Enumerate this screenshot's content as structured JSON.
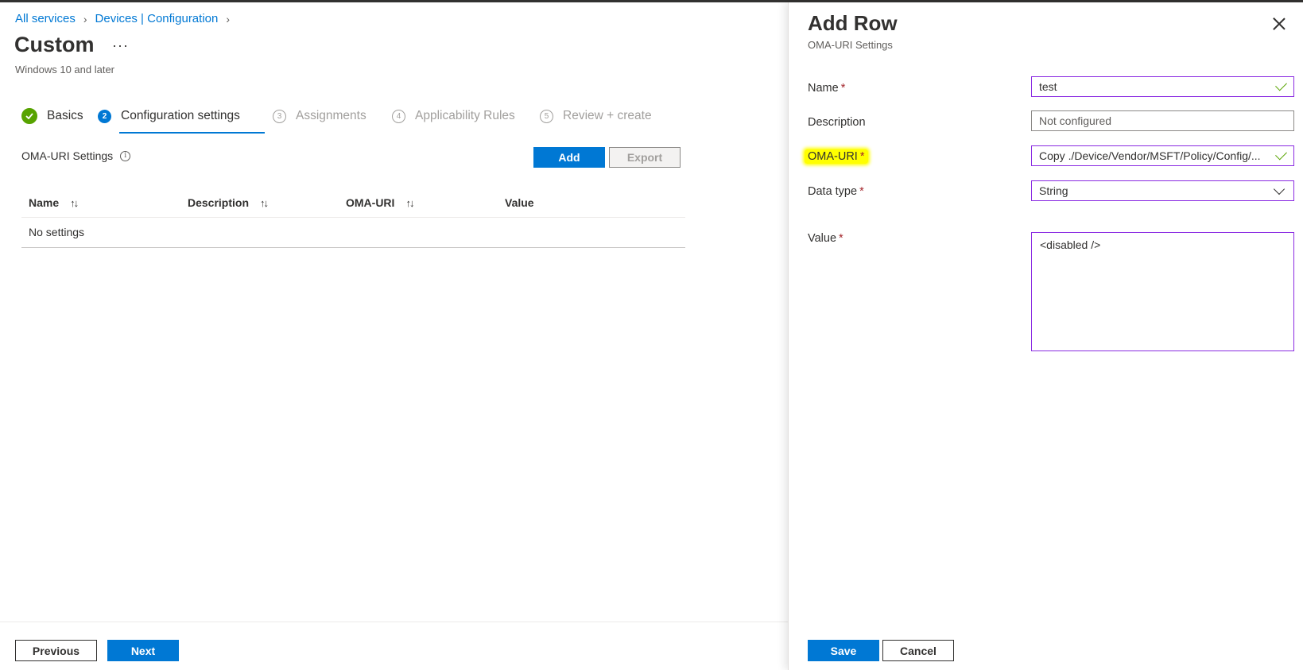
{
  "breadcrumb": {
    "items": [
      "All services",
      "Devices | Configuration"
    ]
  },
  "page": {
    "title": "Custom",
    "more": "···",
    "subtitle": "Windows 10 and later"
  },
  "steps": [
    {
      "num": "✓",
      "label": "Basics",
      "state": "done"
    },
    {
      "num": "2",
      "label": "Configuration settings",
      "state": "active"
    },
    {
      "num": "3",
      "label": "Assignments",
      "state": "disabled"
    },
    {
      "num": "4",
      "label": "Applicability Rules",
      "state": "disabled"
    },
    {
      "num": "5",
      "label": "Review + create",
      "state": "disabled"
    }
  ],
  "settings": {
    "label": "OMA-URI Settings",
    "info_icon": "i",
    "add_label": "Add",
    "export_label": "Export",
    "columns": [
      "Name",
      "Description",
      "OMA-URI",
      "Value"
    ],
    "sort_icon": "↑↓",
    "empty_text": "No settings"
  },
  "footer": {
    "previous_label": "Previous",
    "next_label": "Next"
  },
  "panel": {
    "title": "Add Row",
    "subtitle": "OMA-URI Settings",
    "required_mark": "*",
    "fields": {
      "name": {
        "label": "Name",
        "value": "test"
      },
      "description": {
        "label": "Description",
        "placeholder": "Not configured"
      },
      "oma_uri": {
        "label": "OMA-URI",
        "value": "Copy ./Device/Vendor/MSFT/Policy/Config/..."
      },
      "data_type": {
        "label": "Data type",
        "value": "String"
      },
      "value": {
        "label": "Value",
        "value": "<disabled />"
      }
    },
    "save_label": "Save",
    "cancel_label": "Cancel"
  },
  "colors": {
    "accent": "#0078d4",
    "success": "#57a300",
    "required": "#a4262c",
    "focus_border": "#8a2be2",
    "highlight": "#ffff00"
  }
}
